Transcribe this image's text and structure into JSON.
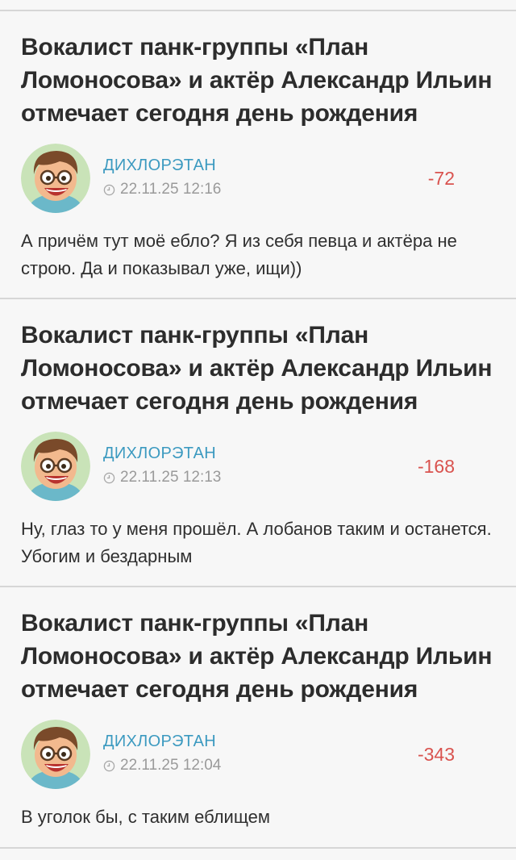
{
  "comments": [
    {
      "article_title": "Вокалист панк-группы «План Ломоносова» и актёр Александр Ильин отмечает сегодня день рождения",
      "author": "ДИХЛОРЭТАН",
      "timestamp": "22.11.25 12:16",
      "rating": "-72",
      "text": "А причём тут моё ебло? Я из себя певца и актёра не строю. Да и показывал уже, ищи))"
    },
    {
      "article_title": "Вокалист панк-группы «План Ломоносова» и актёр Александр Ильин отмечает сегодня день рождения",
      "author": "ДИХЛОРЭТАН",
      "timestamp": "22.11.25 12:13",
      "rating": "-168",
      "text": "Ну, глаз то у меня прошёл. А лобанов таким и останется. Убогим и бездарным"
    },
    {
      "article_title": "Вокалист панк-группы «План Ломоносова» и актёр Александр Ильин отмечает сегодня день рождения",
      "author": "ДИХЛОРЭТАН",
      "timestamp": "22.11.25 12:04",
      "rating": "-343",
      "text": "В уголок бы, с таким еблищем"
    }
  ],
  "icons": {
    "avatar": "cartoon-boy-glasses-avatar",
    "time": "clock-icon"
  },
  "colors": {
    "author": "#3c9ac0",
    "rating_negative": "#d9534f",
    "background": "#f7f7f7",
    "divider": "#d6d6d6"
  }
}
